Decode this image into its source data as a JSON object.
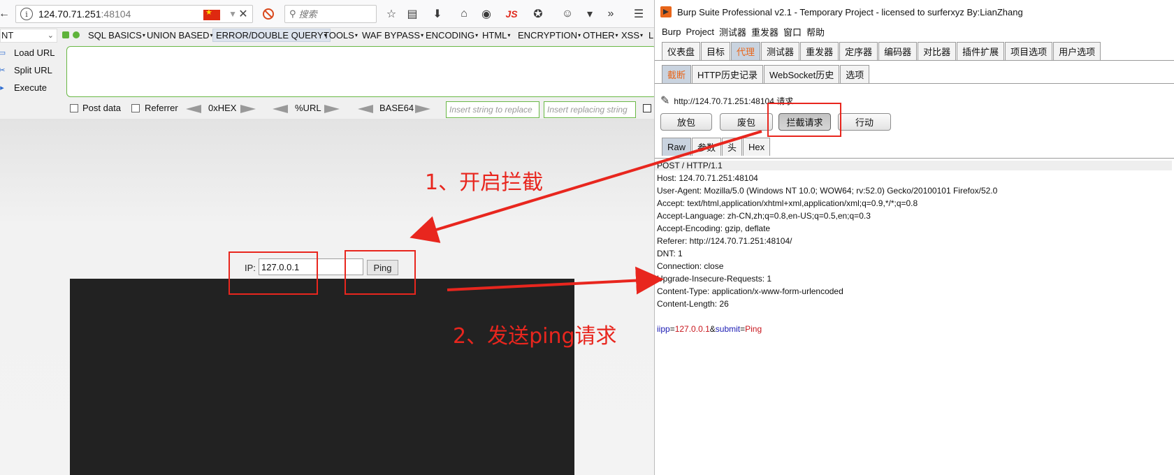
{
  "firefox": {
    "url_host": "124.70.71.251",
    "url_port": ":48104",
    "search_placeholder": "搜索",
    "toolbar_js": "JS"
  },
  "hackbar": {
    "select_value": "NT",
    "menu": [
      "SQL BASICS",
      "UNION BASED",
      "ERROR/DOUBLE QUERY",
      "TOOLS",
      "WAF BYPASS",
      "ENCODING",
      "HTML",
      "ENCRYPTION",
      "OTHER",
      "XSS",
      "L"
    ],
    "active_menu": "ERROR/DOUBLE QUERY",
    "load_url": "Load URL",
    "split_url": "Split URL",
    "execute": "Execute",
    "post_data": "Post data",
    "referrer": "Referrer",
    "hex": "0xHEX",
    "url_enc": "%URL",
    "base64": "BASE64",
    "insert_replace_placeholder": "Insert string to replace",
    "insert_replacing_placeholder": "Insert replacing string"
  },
  "page": {
    "ip_label": "IP:",
    "ip_value": "127.0.0.1",
    "ping_label": "Ping"
  },
  "burp": {
    "title": "Burp Suite Professional v2.1 - Temporary Project - licensed to surferxyz By:LianZhang",
    "menubar": [
      "Burp",
      "Project",
      "测试器",
      "重发器",
      "窗口",
      "帮助"
    ],
    "main_tabs": [
      "仪表盘",
      "目标",
      "代理",
      "测试器",
      "重发器",
      "定序器",
      "编码器",
      "对比器",
      "插件扩展",
      "项目选项",
      "用户选项"
    ],
    "active_main_tab": "代理",
    "proxy_tabs": [
      "截断",
      "HTTP历史记录",
      "WebSocket历史",
      "选项"
    ],
    "active_proxy_tab": "截断",
    "request_url": "http://124.70.71.251:48104 请求",
    "buttons": {
      "forward": "放包",
      "drop": "废包",
      "intercept": "拦截请求",
      "action": "行动"
    },
    "view_tabs": [
      "Raw",
      "参数",
      "头",
      "Hex"
    ],
    "active_view_tab": "Raw",
    "request_lines": [
      "POST / HTTP/1.1",
      "Host: 124.70.71.251:48104",
      "User-Agent: Mozilla/5.0 (Windows NT 10.0; WOW64; rv:52.0) Gecko/20100101 Firefox/52.0",
      "Accept: text/html,application/xhtml+xml,application/xml;q=0.9,*/*;q=0.8",
      "Accept-Language: zh-CN,zh;q=0.8,en-US;q=0.5,en;q=0.3",
      "Accept-Encoding: gzip, deflate",
      "Referer: http://124.70.71.251:48104/",
      "DNT: 1",
      "Connection: close",
      "Upgrade-Insecure-Requests: 1",
      "Content-Type: application/x-www-form-urlencoded",
      "Content-Length: 26"
    ],
    "body": {
      "p1_name": "iipp",
      "p1_value": "127.0.0.1",
      "sep": "&",
      "p2_name": "submit",
      "p2_value": "Ping"
    }
  },
  "annotations": {
    "step1": "1、开启拦截",
    "step2": "2、发送ping请求",
    "color": "#e8261e"
  }
}
